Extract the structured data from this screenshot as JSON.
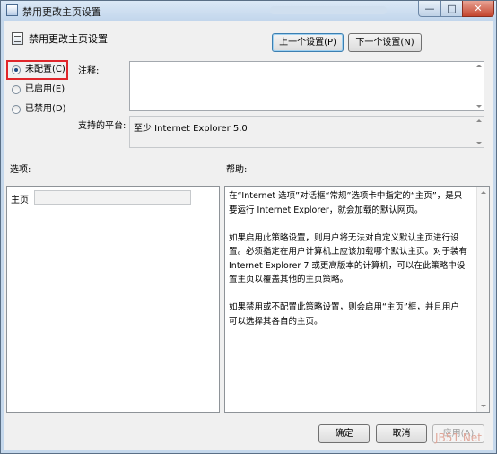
{
  "window": {
    "title": "禁用更改主页设置",
    "controls": {
      "minimize": "—",
      "maximize": "□",
      "close": "✕"
    }
  },
  "header": {
    "title": "禁用更改主页设置",
    "prev_button": "上一个设置(P)",
    "next_button": "下一个设置(N)"
  },
  "state": {
    "options": [
      {
        "label": "未配置(C)",
        "checked": true
      },
      {
        "label": "已启用(E)",
        "checked": false
      },
      {
        "label": "已禁用(D)",
        "checked": false
      }
    ]
  },
  "comment": {
    "label": "注释:",
    "value": ""
  },
  "platform": {
    "label": "支持的平台:",
    "value": "至少 Internet Explorer 5.0"
  },
  "options_section": {
    "label": "选项:",
    "homepage_label": "主页",
    "homepage_value": ""
  },
  "help_section": {
    "label": "帮助:",
    "paragraphs": [
      "在“Internet 选项”对话框“常规”选项卡中指定的“主页”，是只要运行 Internet Explorer，就会加载的默认网页。",
      "如果启用此策略设置，则用户将无法对自定义默认主页进行设置。必须指定在用户计算机上应该加载哪个默认主页。对于装有 Internet Explorer 7 或更高版本的计算机，可以在此策略中设置主页以覆盖其他的主页策略。",
      "如果禁用或不配置此策略设置，则会启用“主页”框，并且用户可以选择其各自的主页。"
    ]
  },
  "footer": {
    "ok": "确定",
    "cancel": "取消",
    "apply": "应用(A)"
  },
  "watermark": "JB51.Net"
}
